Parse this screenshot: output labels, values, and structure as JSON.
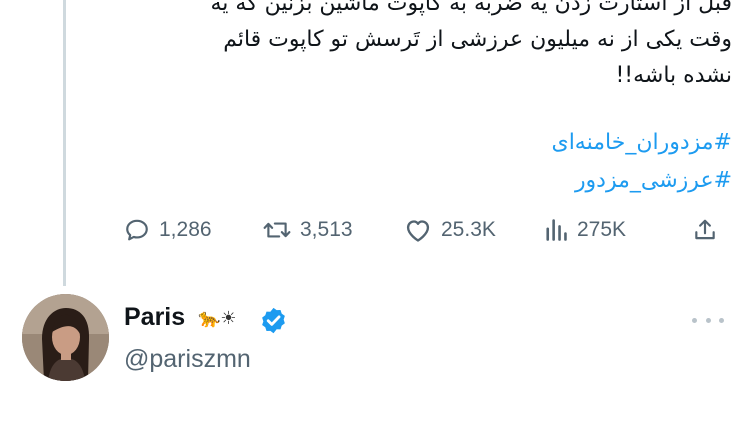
{
  "tweet": {
    "text_lines": [
      "قبل از استارت زدن یه ضربه به کاپوت ماشین بزنین که یه",
      "وقت یکی از نه میلیون عرزشی از تَرسش تو کاپوت قائم",
      "نشده باشه!!"
    ],
    "hashtags": [
      "#مزدوران_خامنه‌ای",
      "#عرزشی_مزدور"
    ]
  },
  "actions": {
    "reply": {
      "icon": "reply-icon",
      "count": "1,286"
    },
    "retweet": {
      "icon": "retweet-icon",
      "count": "3,513"
    },
    "like": {
      "icon": "heart-icon",
      "count": "25.3K"
    },
    "views": {
      "icon": "views-icon",
      "count": "275K"
    },
    "share": {
      "icon": "share-icon"
    }
  },
  "user": {
    "display_name": "Paris",
    "name_emoji": "🐆☀",
    "handle": "@pariszmn",
    "verified": true
  },
  "colors": {
    "hashtag": "#1d9bf0",
    "verified": "#1d9bf0",
    "muted": "#536471",
    "text": "#0f1419",
    "thread_line": "#cfd9de"
  }
}
